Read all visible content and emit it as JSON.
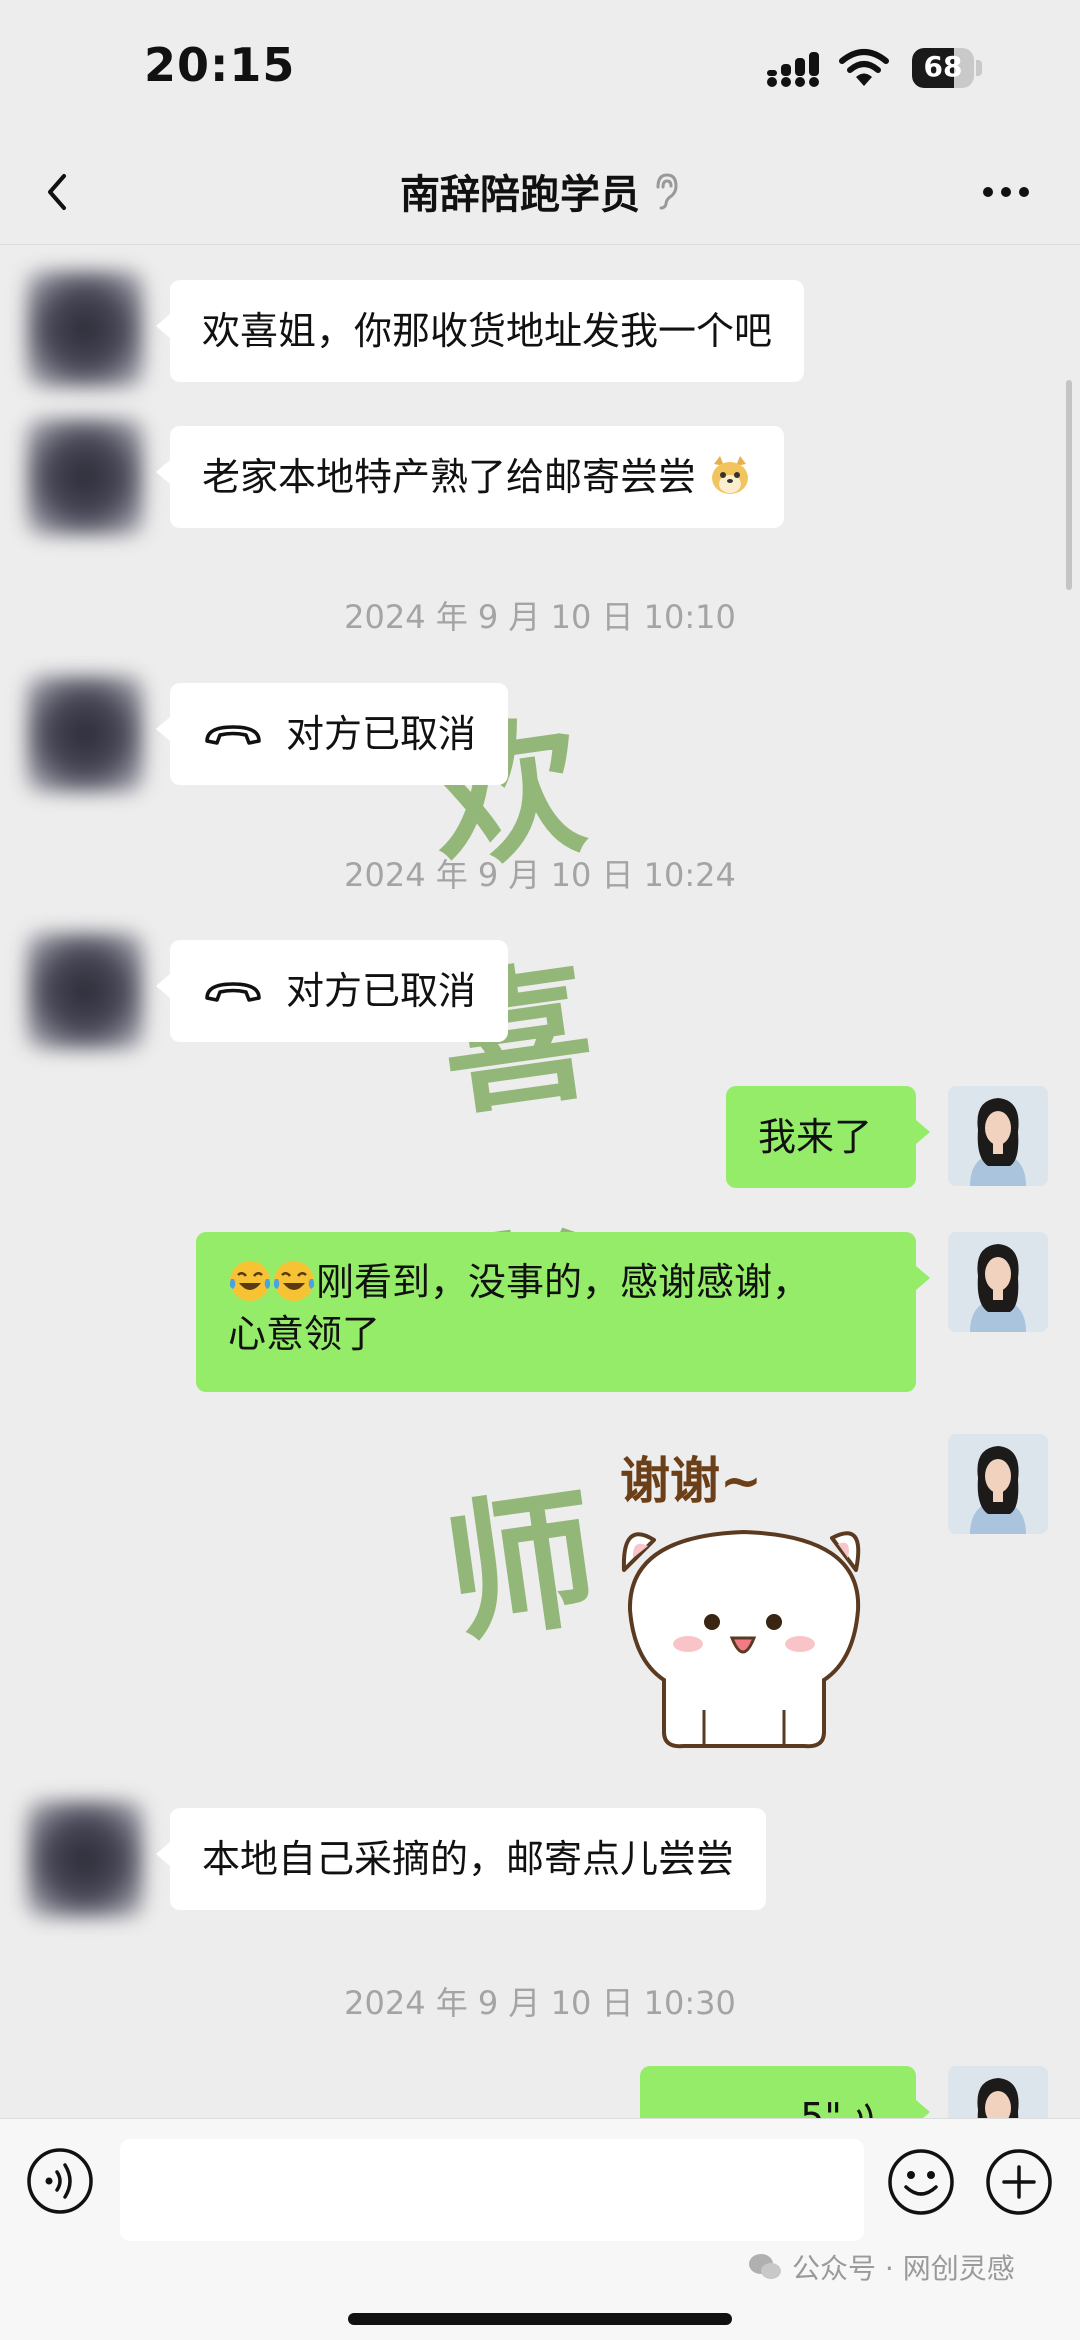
{
  "status_bar": {
    "time": "20:15",
    "battery_percent": "68",
    "battery_level": 0.68
  },
  "header": {
    "title": "南辞陪跑学员"
  },
  "messages": {
    "m1": "欢喜姐，你那收货地址发我一个吧",
    "m2": "老家本地特产熟了给邮寄尝尝",
    "ts1": "2024 年 9 月 10 日 10:10",
    "call1": "对方已取消",
    "ts2": "2024 年 9 月 10 日 10:24",
    "call2": "对方已取消",
    "m3": "我来了",
    "m4_line1": "刚看到，没事的，感谢感谢，",
    "m4_line2": "心意领了",
    "sticker_text": "谢谢~",
    "m5": "本地自己采摘的，邮寄点儿尝尝",
    "ts3": "2024 年 9 月 10 日 10:30",
    "m6_partial": "5\""
  },
  "watermark": {
    "chars": [
      "欢",
      "喜",
      "老",
      "师"
    ],
    "color": "#5c9630"
  },
  "input_bar": {
    "source_label": "公众号 · 网创灵感"
  },
  "colors": {
    "background": "#ededed",
    "bubble_mine": "#95ec69",
    "bubble_theirs": "#ffffff",
    "timestamp": "#a4a4a4"
  }
}
